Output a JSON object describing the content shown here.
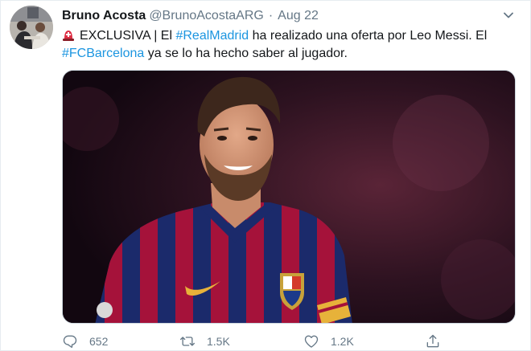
{
  "tweet": {
    "display_name": "Bruno Acosta",
    "handle": "@BrunoAcostaARG",
    "separator": "·",
    "date": "Aug 22",
    "text": {
      "line1_prefix": "EXCLUSIVA | El ",
      "hashtag1": "#RealMadrid",
      "line1_suffix": " ha realizado una oferta por Leo Messi. El",
      "hashtag2": "#FCBarcelona",
      "line2_suffix": " ya se lo ha hecho saber al jugador."
    },
    "icons": {
      "emoji": "police-siren-icon",
      "menu": "chevron-down-icon",
      "reply": "reply-icon",
      "retweet": "retweet-icon",
      "like": "heart-icon",
      "share": "share-icon"
    },
    "actions": {
      "replies": "652",
      "retweets": "1.5K",
      "likes": "1.2K"
    }
  },
  "colors": {
    "link": "#1b95e0",
    "secondary_text": "#657786",
    "primary_text": "#14171a"
  }
}
